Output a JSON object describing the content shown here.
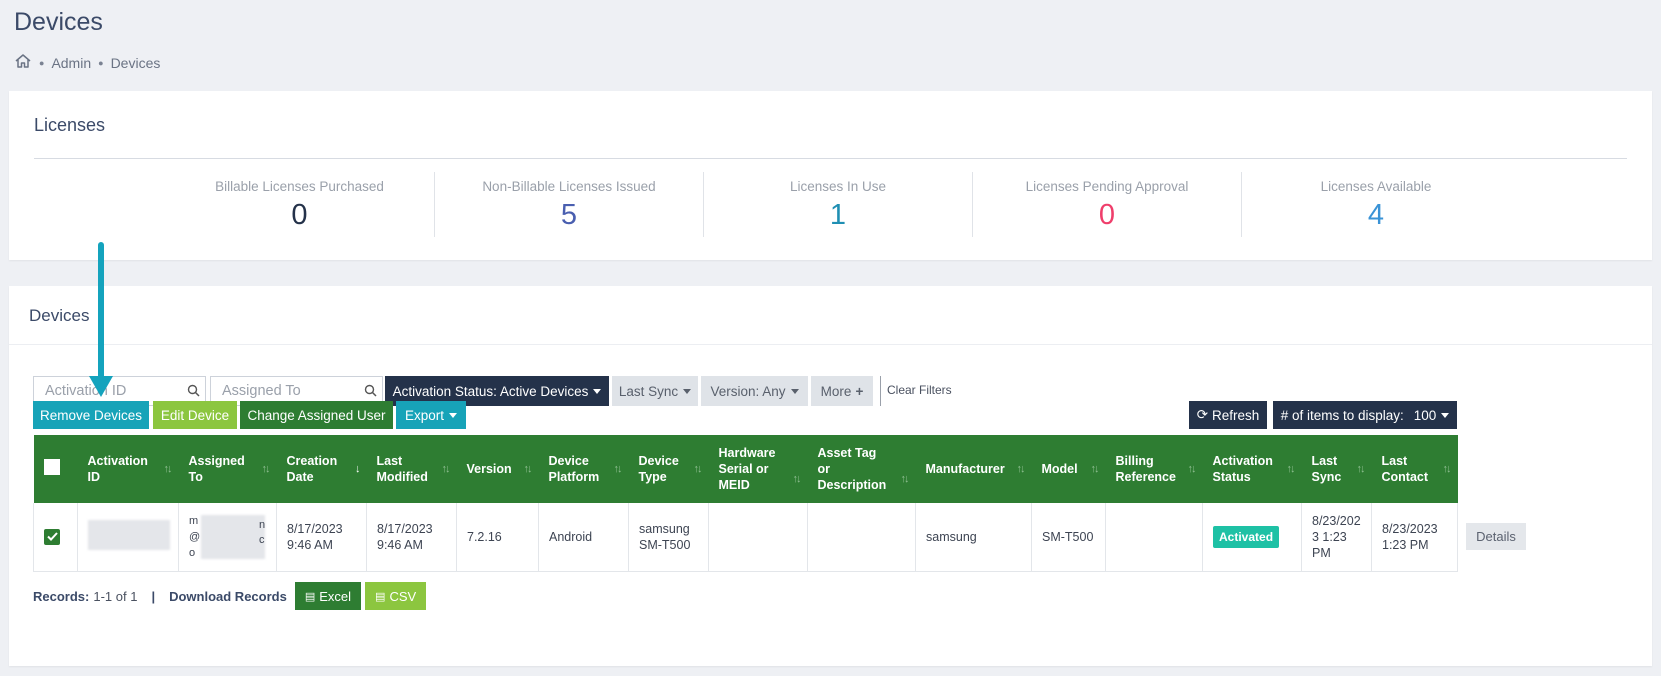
{
  "page": {
    "title": "Devices"
  },
  "breadcrumb": {
    "items": [
      "Admin",
      "Devices"
    ]
  },
  "licenses": {
    "title": "Licenses",
    "stats": [
      {
        "label": "Billable Licenses Purchased",
        "value": "0",
        "color": "#24324a"
      },
      {
        "label": "Non-Billable Licenses Issued",
        "value": "5",
        "color": "#4a5fb0"
      },
      {
        "label": "Licenses In Use",
        "value": "1",
        "color": "#1f8fb3"
      },
      {
        "label": "Licenses Pending Approval",
        "value": "0",
        "color": "#ef3e6b"
      },
      {
        "label": "Licenses Available",
        "value": "4",
        "color": "#3a93d6"
      }
    ]
  },
  "devices": {
    "title": "Devices",
    "search_activation": {
      "placeholder": "Activation ID"
    },
    "search_assigned": {
      "placeholder": "Assigned To"
    },
    "filters": {
      "activation_status": "Activation Status: Active Devices",
      "last_sync": "Last Sync",
      "version": "Version: Any",
      "more": "More",
      "clear": "Clear Filters"
    },
    "actions": {
      "remove": "Remove Devices",
      "edit": "Edit Device",
      "change_user": "Change Assigned User",
      "export": "Export",
      "refresh": "Refresh",
      "items_label": "# of items to display:",
      "items_value": "100"
    },
    "table": {
      "columns": [
        [
          "Activation",
          "ID"
        ],
        [
          "Assigned",
          "To"
        ],
        [
          "Creation",
          "Date"
        ],
        [
          "Last",
          "Modified"
        ],
        [
          "Version"
        ],
        [
          "Device",
          "Platform"
        ],
        [
          "Device",
          "Type"
        ],
        [
          "Hardware",
          "Serial or",
          "MEID"
        ],
        [
          "Asset Tag",
          "or",
          "Description"
        ],
        [
          "Manufacturer"
        ],
        [
          "Model"
        ],
        [
          "Billing",
          "Reference"
        ],
        [
          "Activation",
          "Status"
        ],
        [
          "Last",
          "Sync"
        ],
        [
          "Last",
          "Contact"
        ]
      ],
      "row": {
        "assigned_fragments": [
          "m",
          "n",
          "@",
          "c",
          "o"
        ],
        "creation_date": [
          "8/17/2023",
          "9:46 AM"
        ],
        "last_modified": [
          "8/17/2023",
          "9:46 AM"
        ],
        "version": "7.2.16",
        "platform": "Android",
        "device_type": [
          "samsung",
          "SM-T500"
        ],
        "manufacturer": "samsung",
        "model": "SM-T500",
        "status": "Activated",
        "last_sync": [
          "8/23/202",
          "3 1:23 PM"
        ],
        "last_contact": [
          "8/23/2023",
          "1:23 PM"
        ],
        "details": "Details"
      }
    },
    "records": {
      "label": "Records:",
      "value": "1-1 of 1",
      "download": "Download Records",
      "excel": "Excel",
      "csv": "CSV"
    }
  },
  "colors": {
    "accent_green": "#2e7d32",
    "teal": "#17a3b8",
    "lime": "#8cc63f",
    "navy": "#24324a"
  }
}
